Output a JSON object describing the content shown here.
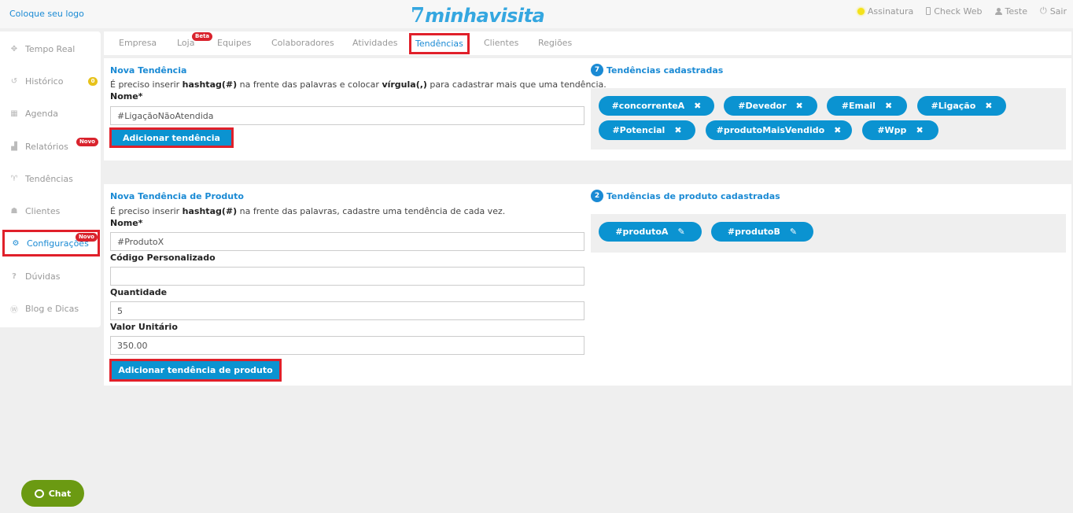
{
  "header": {
    "logo_placeholder": "Coloque seu logo",
    "brand": "minhavisita",
    "links": [
      {
        "label": "Assinatura",
        "icon": "subscription-dot-icon"
      },
      {
        "label": "Check Web",
        "icon": "phone-icon"
      },
      {
        "label": "Teste",
        "icon": "user-icon"
      },
      {
        "label": "Sair",
        "icon": "power-icon"
      }
    ]
  },
  "sidebar": {
    "items": [
      {
        "label": "Tempo Real",
        "icon": "crosshair-icon"
      },
      {
        "label": "Histórico",
        "icon": "history-icon",
        "badge": "0"
      },
      {
        "label": "Agenda",
        "icon": "calendar-icon"
      },
      {
        "label": "Relatórios",
        "icon": "chart-icon",
        "badge": "Novo"
      },
      {
        "label": "Tendências",
        "icon": "trophy-icon"
      },
      {
        "label": "Clientes",
        "icon": "users-icon"
      },
      {
        "label": "Configurações",
        "icon": "gears-icon",
        "badge": "Novo"
      },
      {
        "label": "Dúvidas",
        "icon": "question-icon"
      },
      {
        "label": "Blog e Dicas",
        "icon": "wordpress-icon"
      }
    ]
  },
  "tabs": [
    {
      "label": "Empresa"
    },
    {
      "label": "Loja",
      "badge": "Beta"
    },
    {
      "label": "Equipes"
    },
    {
      "label": "Colaboradores"
    },
    {
      "label": "Atividades"
    },
    {
      "label": "Tendências"
    },
    {
      "label": "Clientes"
    },
    {
      "label": "Regiões"
    }
  ],
  "trend_form": {
    "title": "Nova Tendência",
    "note_a": "É preciso inserir ",
    "note_b": "hashtag(#)",
    "note_c": " na frente das palavras e colocar ",
    "note_d": "vírgula(,)",
    "note_e": " para cadastrar mais que uma tendência.",
    "name_label": "Nome*",
    "name_value": "#LigaçãoNãoAtendida",
    "button": "Adicionar tendência"
  },
  "trend_list": {
    "count": "7",
    "title": "Tendências cadastradas",
    "tags": [
      "#concorrenteA",
      "#Devedor",
      "#Email",
      "#Ligação",
      "#Potencial",
      "#produtoMaisVendido",
      "#Wpp"
    ]
  },
  "product_form": {
    "title": "Nova Tendência de Produto",
    "note_a": "É preciso inserir ",
    "note_b": "hashtag(#)",
    "note_c": " na frente das palavras, cadastre uma tendência de cada vez.",
    "name_label": "Nome*",
    "name_value": "#ProdutoX",
    "code_label": "Código Personalizado",
    "code_value": "",
    "qty_label": "Quantidade",
    "qty_value": "5",
    "price_label": "Valor Unitário",
    "price_value": "350.00",
    "button": "Adicionar tendência de produto"
  },
  "product_list": {
    "count": "2",
    "title": "Tendências de produto cadastradas",
    "tags": [
      "#produtoA",
      "#produtoB"
    ]
  },
  "chat": {
    "label": "Chat"
  },
  "colors": {
    "accent": "#0b93d1",
    "highlight": "#e0202a",
    "chat": "#6b9a12"
  }
}
